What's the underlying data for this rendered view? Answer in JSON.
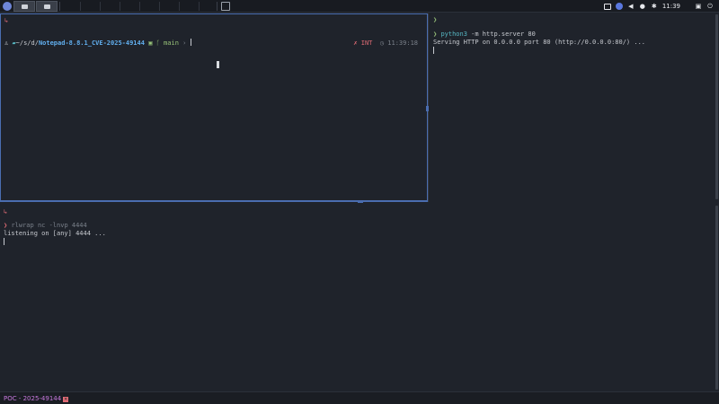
{
  "topbar": {
    "clock": "11:39",
    "icons": [
      "app-menu-icon",
      "window-icon",
      "globe-icon",
      "volume-icon",
      "bell-icon",
      "settings-icon",
      "lock-icon",
      "power-icon"
    ]
  },
  "left_pane": {
    "status_marker": "↳",
    "prompt_path_prefix": "~/s/d/",
    "prompt_dir": "Notepad-8.8.1_CVE-2025-49144",
    "git_branch": "main",
    "prompt_end": "›",
    "right_status": "✗ INT",
    "right_time": "11:39:18"
  },
  "right_pane": {
    "prompt_symbol": "❯",
    "command_name": "python3",
    "command_args": " -m http.server 80",
    "output": "Serving HTTP on 0.0.0.0 port 80 (http://0.0.0.0:80/) ..."
  },
  "bottom_pane": {
    "status_marker": "↳",
    "prompt_symbol": "❯",
    "command": "rlwrap nc -lnvp 4444",
    "output": "listening on [any] 4444 ..."
  },
  "statusbar": {
    "tab_label": "POC - 2025-49144"
  },
  "colors": {
    "background": "#1f232b",
    "active_border": "#4a6db0",
    "error_red": "#e06c75",
    "accent_purple": "#c678dd"
  }
}
